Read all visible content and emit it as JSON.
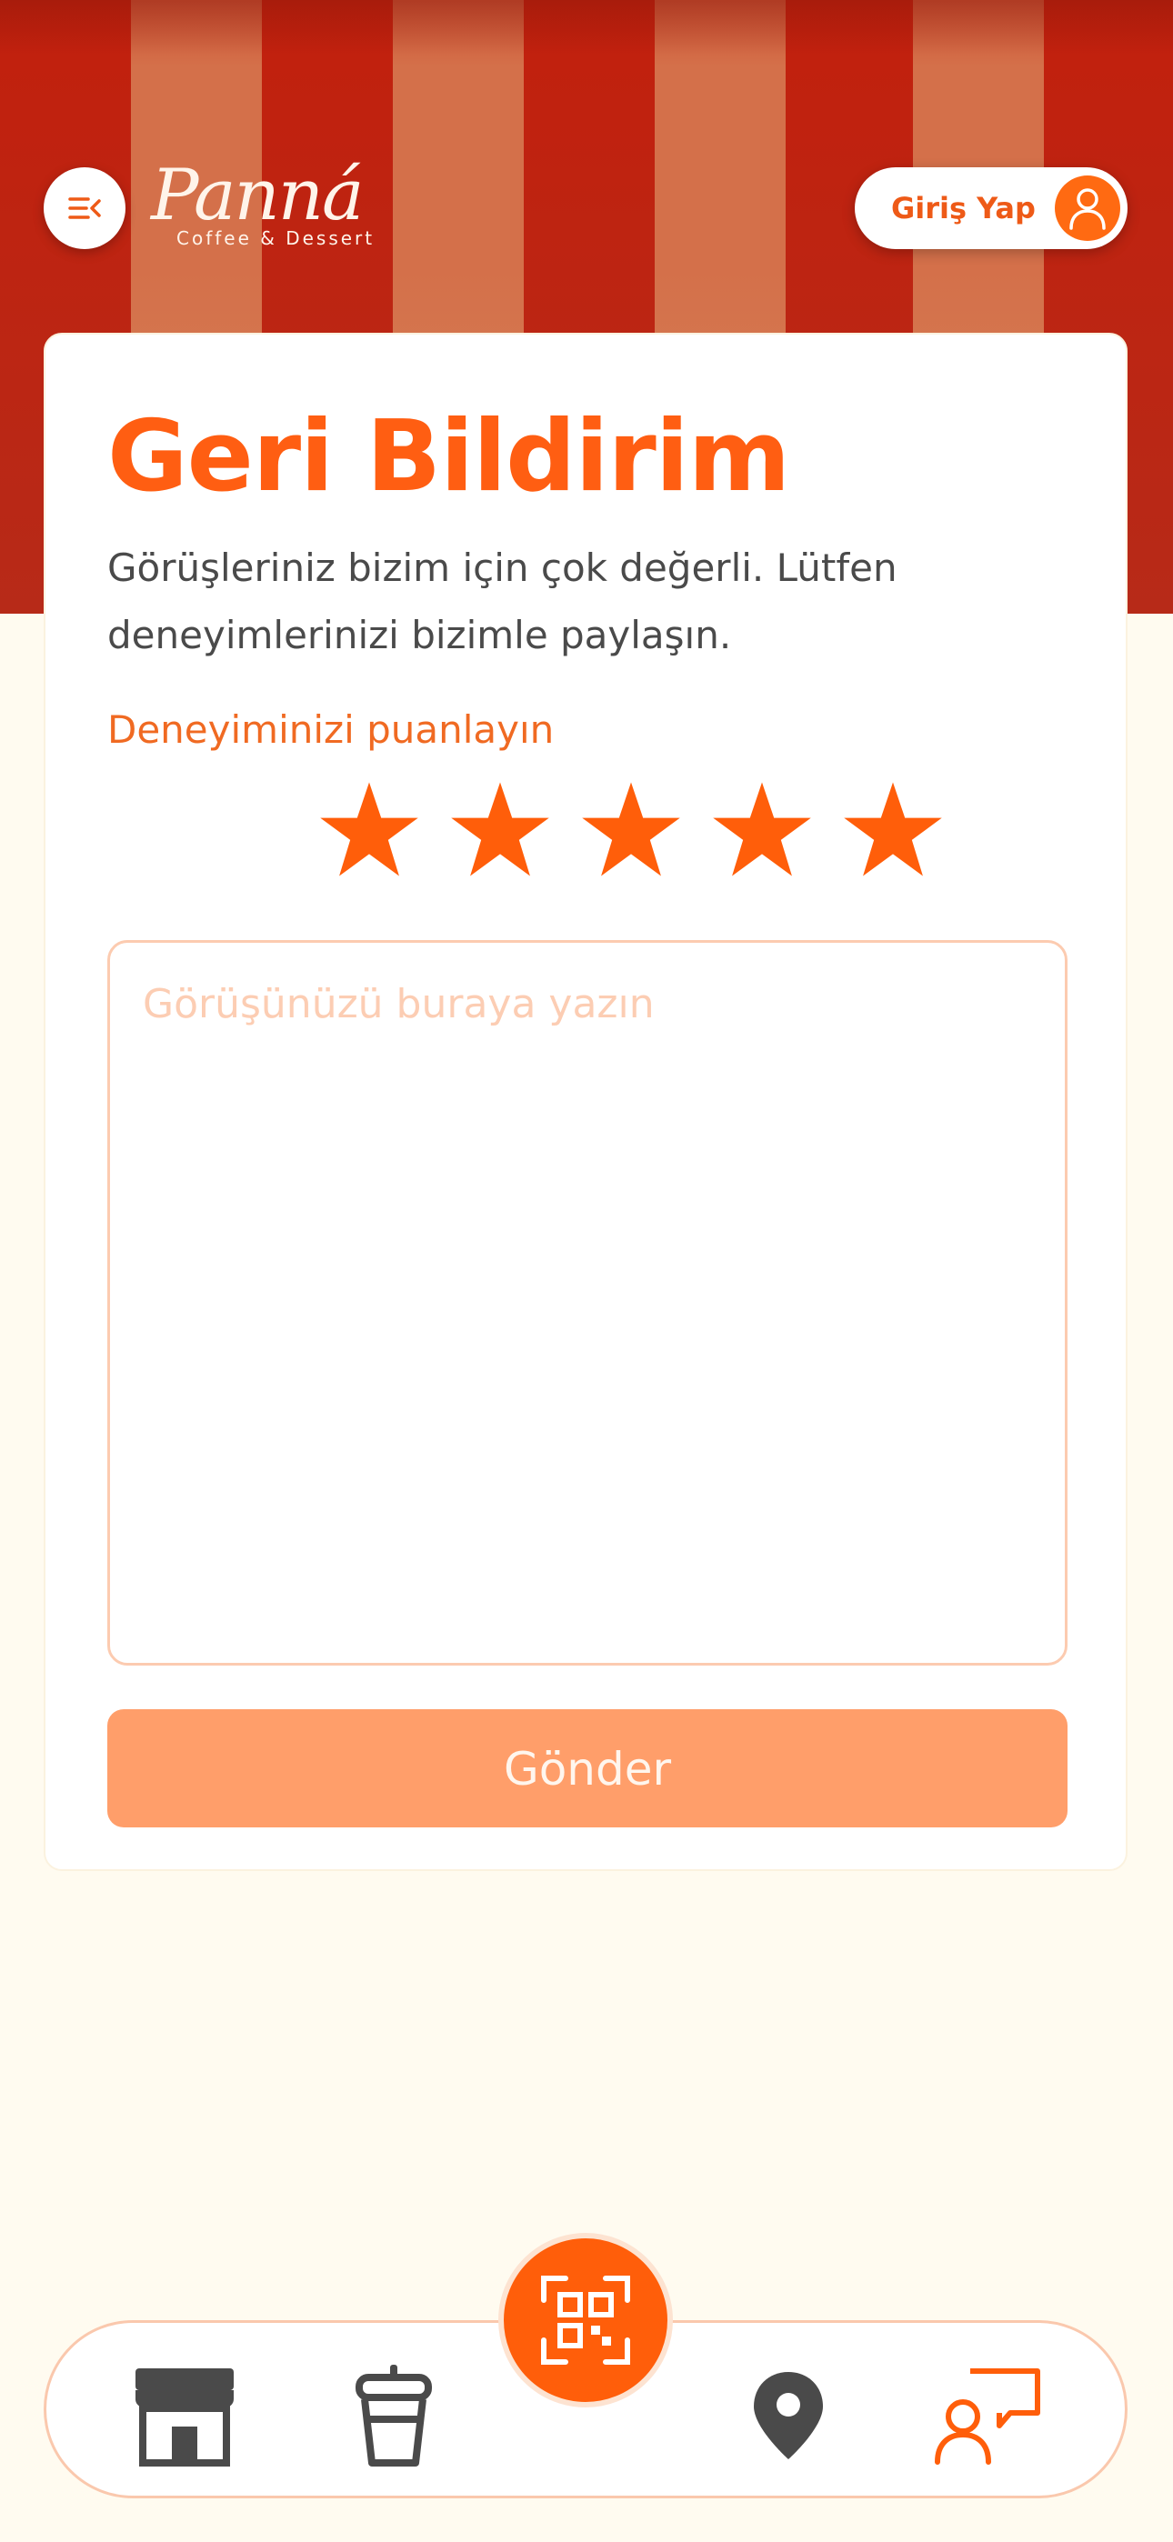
{
  "colors": {
    "brand_orange": "#FF5E12",
    "awning_red": "#C2200D",
    "background": "#FFFBF0",
    "button_disabled": "#FF9E6A",
    "icon_dark": "#4A4A4A"
  },
  "header": {
    "logo_text": "Panná",
    "logo_subtitle": "Coffee & Dessert",
    "menu_icon": "menu-collapse-icon",
    "login_label": "Giriş Yap",
    "login_icon": "user-icon"
  },
  "feedback": {
    "title": "Geri Bildirim",
    "description": "Görüşleriniz bizim için çok değerli. Lütfen deneyimlerinizi bizimle paylaşın.",
    "rating_label": "Deneyiminizi puanlayın",
    "rating": 5,
    "rating_max": 5,
    "comment_placeholder": "Görüşünüzü buraya yazın",
    "comment_value": "",
    "submit_label": "Gönder"
  },
  "bottom_nav": {
    "items": [
      {
        "icon": "store-icon"
      },
      {
        "icon": "coffee-cup-icon"
      },
      {
        "icon": "qr-code-icon"
      },
      {
        "icon": "location-pin-icon"
      },
      {
        "icon": "feedback-chat-icon",
        "active": true
      }
    ]
  }
}
